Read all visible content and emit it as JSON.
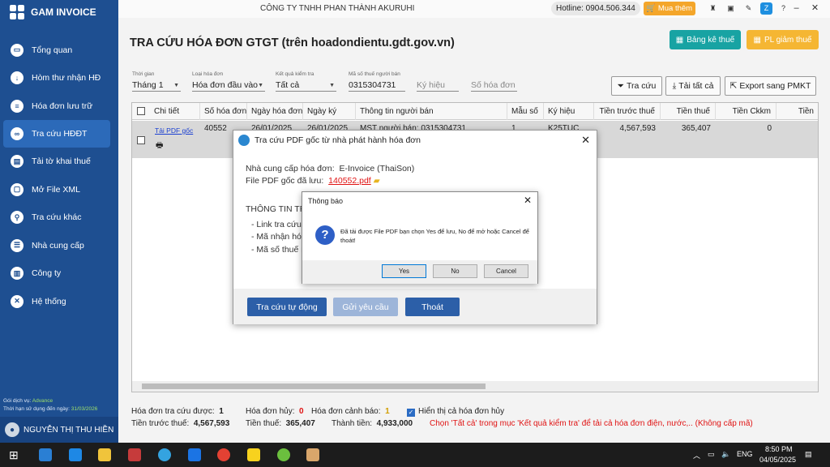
{
  "app": {
    "name": "GAM INVOICE",
    "company": "CÔNG TY TNHH PHAN THÀNH AKURUHI"
  },
  "topbar": {
    "hotline": "Hotline: 0904.506.344",
    "buy_label": "Mua thêm"
  },
  "sidebar": {
    "items": [
      {
        "label": "Tổng quan",
        "icon": "monitor-icon"
      },
      {
        "label": "Hòm thư nhận HĐ",
        "icon": "download-icon"
      },
      {
        "label": "Hóa đơn lưu trữ",
        "icon": "document-icon"
      },
      {
        "label": "Tra cứu HĐĐT",
        "icon": "link-icon"
      },
      {
        "label": "Tải tờ khai thuế",
        "icon": "form-icon"
      },
      {
        "label": "Mở File XML",
        "icon": "folder-icon"
      },
      {
        "label": "Tra cứu khác",
        "icon": "search-icon"
      },
      {
        "label": "Nhà cung cấp",
        "icon": "contact-icon"
      },
      {
        "label": "Công ty",
        "icon": "building-icon"
      },
      {
        "label": "Hệ thống",
        "icon": "tools-icon"
      }
    ],
    "service_label": "Gói dịch vụ:",
    "service_value": "Advance",
    "expiry_label": "Thời hạn sử dụng đến ngày:",
    "expiry_value": "31/03/2026",
    "user": "NGUYỄN THỊ THU HIỀN"
  },
  "main": {
    "title": "TRA CỨU HÓA ĐƠN GTGT (trên hoadondientu.gdt.gov.vn)",
    "btn_bangke": "Bảng kê thuế",
    "btn_pl": "PL giảm thuế",
    "filters": {
      "period_label": "Thời gian",
      "period_value": "Tháng 1",
      "type_label": "Loại hóa đơn",
      "type_value": "Hóa đơn đầu vào",
      "result_label": "Kết quả kiểm tra",
      "result_value": "Tất cả",
      "tax_label": "Mã số thuế người bán",
      "tax_value": "0315304731",
      "symbol_placeholder": "Ký hiệu",
      "number_placeholder": "Số hóa đơn"
    },
    "actions": {
      "lookup": "Tra cứu",
      "download_all": "Tải tất cả",
      "export": "Export sang PMKT"
    }
  },
  "grid": {
    "columns": [
      "Chi tiết",
      "Số hóa đơn",
      "Ngày hóa đơn",
      "Ngày ký",
      "Thông tin người bán",
      "Mẫu số",
      "Ký hiệu",
      "Tiền trước thuế",
      "Tiền thuế",
      "Tiền Ckkm",
      "Tiền"
    ],
    "row": {
      "link": "Tải PDF gốc",
      "number": "40552",
      "date": "26/01/2025",
      "sign_date": "26/01/2025",
      "seller": "MST người bán: 0315304731",
      "form": "1",
      "symbol": "K25TUC",
      "pre_tax": "4,567,593",
      "tax": "365,407",
      "discount": "0"
    }
  },
  "summary": {
    "looked_up_label": "Hóa đơn tra cứu được:",
    "looked_up_value": "1",
    "cancelled_label": "Hóa đơn hủy:",
    "cancelled_value": "0",
    "warning_label": "Hóa đơn cảnh báo:",
    "warning_value": "1",
    "show_cancelled_label": "Hiển thị cả hóa đơn hủy",
    "pre_tax_label": "Tiền trước thuế:",
    "pre_tax_value": "4,567,593",
    "tax_label": "Tiền thuế:",
    "tax_value": "365,407",
    "total_label": "Thành tiền:",
    "total_value": "4,933,000",
    "hint": "Chọn 'Tất cả' trong mục 'Kết quả kiểm tra' để tải cả hóa đơn điện, nước,.. (Không cấp mã)"
  },
  "dialog_pdf": {
    "title": "Tra cứu PDF gốc từ nhà phát hành hóa đơn",
    "provider_label": "Nhà cung cấp hóa đơn:",
    "provider_value": "E-Invoice (ThaiSon)",
    "file_label": "File PDF gốc đã lưu:",
    "file_value": "140552.pdf",
    "info_heading": "THÔNG TIN TRA",
    "info_link": "- Link tra cứu:",
    "info_code": "- Mã nhận hóa",
    "info_tax": "- Mã số thuế ng",
    "btn_auto": "Tra cứu tự động",
    "btn_request": "Gửi yêu cầu",
    "btn_exit": "Thoát"
  },
  "dialog_msg": {
    "title": "Thông báo",
    "message": "Đã tải được File PDF bạn chọn Yes để lưu, No để mở hoặc Cancel để thoát!",
    "yes": "Yes",
    "no": "No",
    "cancel": "Cancel"
  },
  "taskbar": {
    "lang": "ENG",
    "time": "8:50 PM",
    "date": "04/05/2025"
  },
  "colors": {
    "sidebar": "#1e4f91",
    "accent_teal": "#18a3a3",
    "accent_orange": "#f5b633",
    "button_blue": "#2c5fa8",
    "alert_red": "#e01313"
  }
}
